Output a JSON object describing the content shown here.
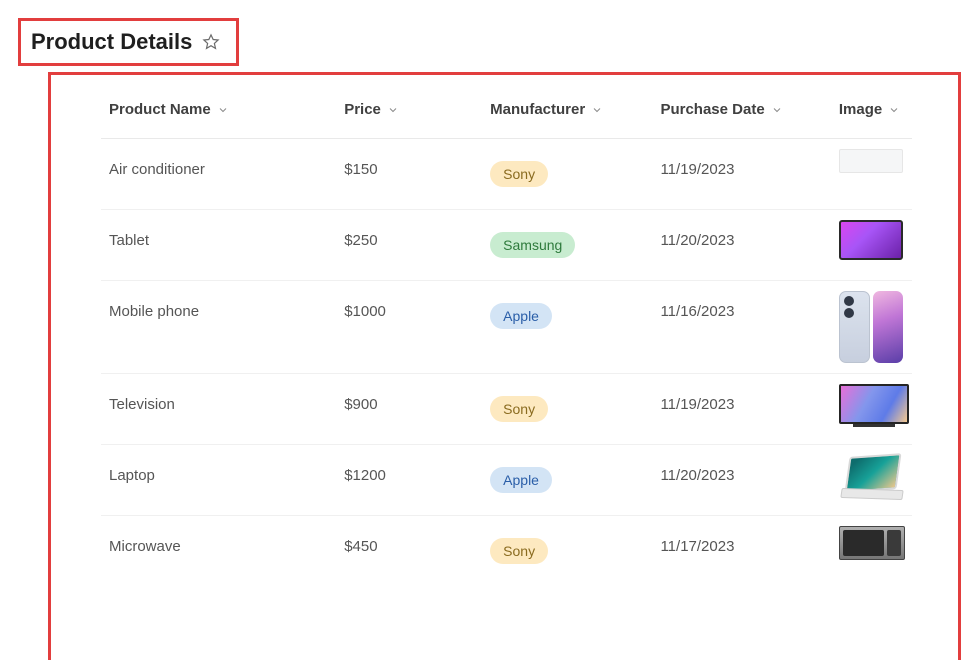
{
  "header": {
    "title": "Product Details"
  },
  "columns": {
    "name": "Product Name",
    "price": "Price",
    "manufacturer": "Manufacturer",
    "date": "Purchase Date",
    "image": "Image"
  },
  "rows": [
    {
      "name": "Air conditioner",
      "price": "$150",
      "manufacturer": "Sony",
      "mfr_class": "pill-sony",
      "date": "11/19/2023",
      "image_type": "ac"
    },
    {
      "name": "Tablet",
      "price": "$250",
      "manufacturer": "Samsung",
      "mfr_class": "pill-samsung",
      "date": "11/20/2023",
      "image_type": "tablet"
    },
    {
      "name": "Mobile phone",
      "price": "$1000",
      "manufacturer": "Apple",
      "mfr_class": "pill-apple",
      "date": "11/16/2023",
      "image_type": "phone"
    },
    {
      "name": "Television",
      "price": "$900",
      "manufacturer": "Sony",
      "mfr_class": "pill-sony",
      "date": "11/19/2023",
      "image_type": "tv"
    },
    {
      "name": "Laptop",
      "price": "$1200",
      "manufacturer": "Apple",
      "mfr_class": "pill-apple",
      "date": "11/20/2023",
      "image_type": "laptop"
    },
    {
      "name": "Microwave",
      "price": "$450",
      "manufacturer": "Sony",
      "mfr_class": "pill-sony",
      "date": "11/17/2023",
      "image_type": "microwave"
    }
  ]
}
